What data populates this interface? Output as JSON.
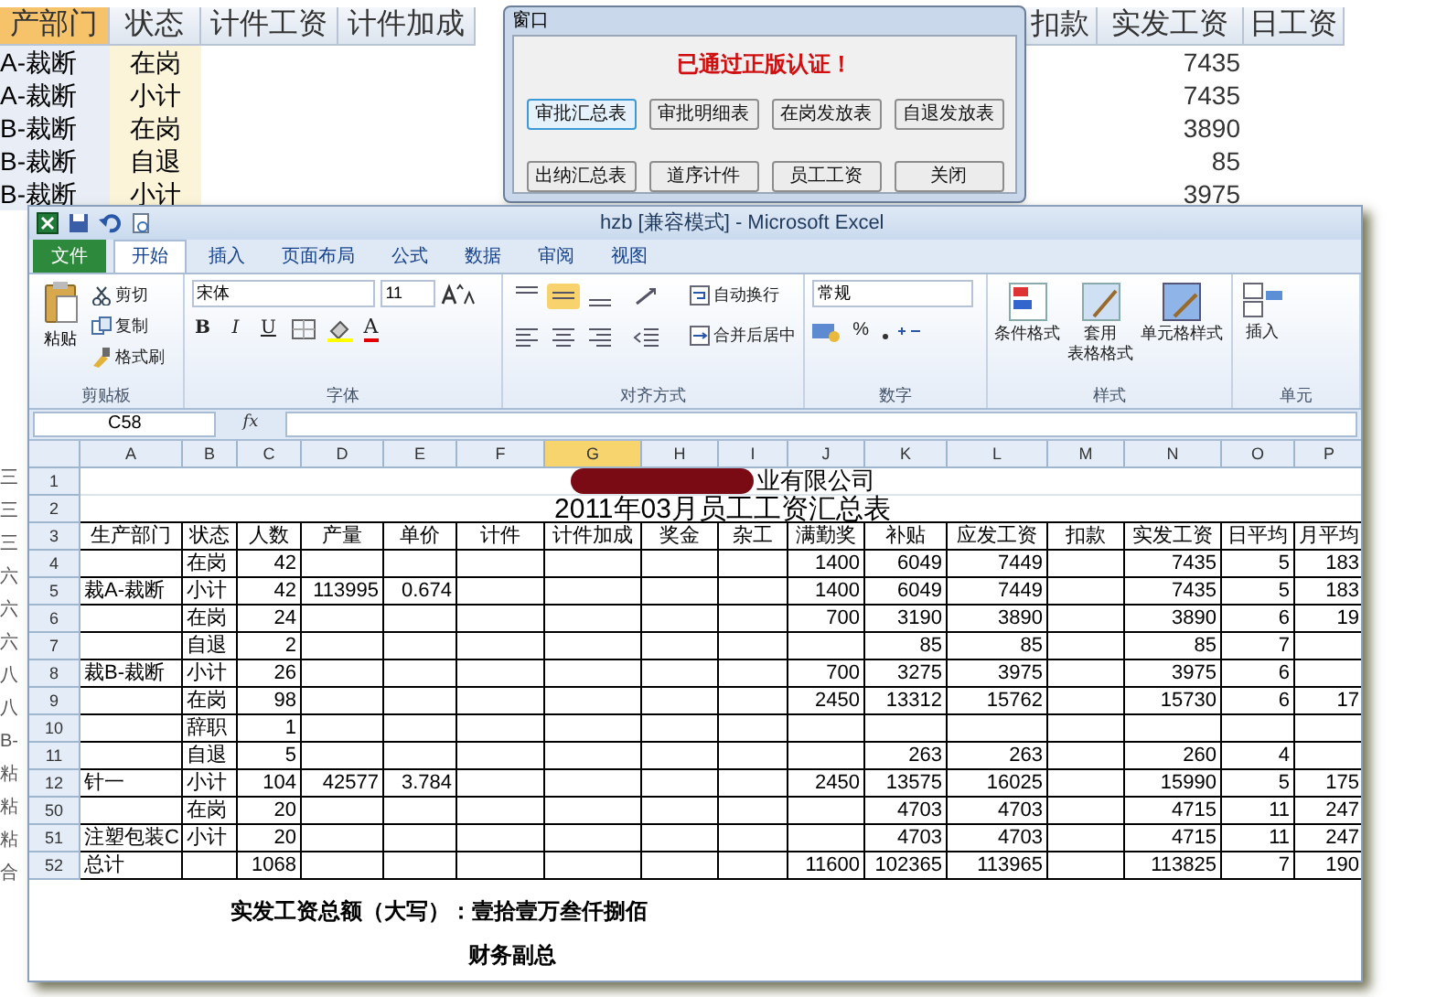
{
  "background_sheet": {
    "columns": [
      {
        "label": "产部门",
        "selected": true
      },
      {
        "label": "状态",
        "selected": false
      },
      {
        "label": "计件工资",
        "selected": false
      },
      {
        "label": "计件加成",
        "selected": false
      },
      {
        "label": "扣款",
        "selected": false
      },
      {
        "label": "实发工资",
        "selected": false
      },
      {
        "label": "日工资",
        "selected": false
      }
    ],
    "rows": [
      {
        "dept": "A-裁断",
        "status": "在岗",
        "net_pay": "7435"
      },
      {
        "dept": "A-裁断",
        "status": "小计",
        "net_pay": "7435"
      },
      {
        "dept": "B-裁断",
        "status": "在岗",
        "net_pay": "3890"
      },
      {
        "dept": "B-裁断",
        "status": "自退",
        "net_pay": "85"
      },
      {
        "dept": "B-裁断",
        "status": "小计",
        "net_pay": "3975"
      }
    ],
    "edge_labels": [
      "三",
      "三",
      "三",
      "六",
      "六",
      "六",
      "八",
      "八",
      "B-",
      "粘",
      "粘",
      "粘",
      "合"
    ]
  },
  "dialog": {
    "title": "窗口",
    "message": "已通过正版认证！",
    "buttons": [
      {
        "label": "审批汇总表",
        "focused": true
      },
      {
        "label": "审批明细表",
        "focused": false
      },
      {
        "label": "在岗发放表",
        "focused": false
      },
      {
        "label": "自退发放表",
        "focused": false
      },
      {
        "label": "出纳汇总表",
        "focused": false
      },
      {
        "label": "道序计件",
        "focused": false
      },
      {
        "label": "员工工资",
        "focused": false
      },
      {
        "label": "关闭",
        "focused": false
      }
    ]
  },
  "excel": {
    "title": "hzb  [兼容模式] - Microsoft Excel",
    "tabs": [
      {
        "label": "文件",
        "kind": "file",
        "selected": false
      },
      {
        "label": "开始",
        "kind": "tab",
        "selected": true
      },
      {
        "label": "插入",
        "kind": "tab",
        "selected": false
      },
      {
        "label": "页面布局",
        "kind": "tab",
        "selected": false
      },
      {
        "label": "公式",
        "kind": "tab",
        "selected": false
      },
      {
        "label": "数据",
        "kind": "tab",
        "selected": false
      },
      {
        "label": "审阅",
        "kind": "tab",
        "selected": false
      },
      {
        "label": "视图",
        "kind": "tab",
        "selected": false
      }
    ],
    "ribbon": {
      "clipboard": {
        "label": "剪贴板",
        "paste": "粘贴",
        "items": [
          "剪切",
          "复制",
          "格式刷"
        ]
      },
      "font": {
        "label": "字体",
        "font_name": "宋体",
        "font_size": "11",
        "styles": [
          "B",
          "I",
          "U"
        ],
        "color_letter": "A"
      },
      "alignment": {
        "label": "对齐方式",
        "wrap": "自动换行",
        "merge": "合并后居中"
      },
      "number": {
        "label": "数字",
        "format": "常规",
        "percent": "%"
      },
      "styles": {
        "label": "样式",
        "items": [
          [
            "条件格式"
          ],
          [
            "套用",
            "表格格式"
          ],
          [
            "单元格样式"
          ]
        ]
      },
      "cells": {
        "label": "单元",
        "items": [
          "插入"
        ]
      }
    },
    "name_box": "C58",
    "function_label": "fx",
    "columns": [
      {
        "label": "A",
        "selected": false
      },
      {
        "label": "B",
        "selected": false
      },
      {
        "label": "C",
        "selected": false
      },
      {
        "label": "D",
        "selected": false
      },
      {
        "label": "E",
        "selected": false
      },
      {
        "label": "F",
        "selected": false
      },
      {
        "label": "G",
        "selected": true
      },
      {
        "label": "H",
        "selected": false
      },
      {
        "label": "I",
        "selected": false
      },
      {
        "label": "J",
        "selected": false
      },
      {
        "label": "K",
        "selected": false
      },
      {
        "label": "L",
        "selected": false
      },
      {
        "label": "M",
        "selected": false
      },
      {
        "label": "N",
        "selected": false
      },
      {
        "label": "O",
        "selected": false
      },
      {
        "label": "P",
        "selected": false
      }
    ],
    "rows": [
      {
        "number": "1",
        "kind": "company",
        "text": "业有限公司"
      },
      {
        "number": "2",
        "kind": "title",
        "text": "2011年03月员工工资汇总表"
      },
      {
        "number": "3",
        "kind": "header",
        "cells": [
          "生产部门",
          "状态",
          "人数",
          "产量",
          "单价",
          "计件",
          "计件加成",
          "奖金",
          "杂工",
          "满勤奖",
          "补贴",
          "应发工资",
          "扣款",
          "实发工资",
          "日平均",
          "月平均"
        ]
      },
      {
        "number": "4",
        "kind": "data",
        "cells": [
          null,
          "在岗",
          "42",
          null,
          null,
          null,
          null,
          null,
          null,
          "1400",
          "6049",
          "7449",
          null,
          "7435",
          "5",
          "183"
        ]
      },
      {
        "number": "5",
        "kind": "data",
        "cells": [
          "裁A-裁断",
          "小计",
          "42",
          "113995",
          "0.674",
          null,
          null,
          null,
          null,
          "1400",
          "6049",
          "7449",
          null,
          "7435",
          "5",
          "183"
        ]
      },
      {
        "number": "6",
        "kind": "data",
        "cells": [
          null,
          "在岗",
          "24",
          null,
          null,
          null,
          null,
          null,
          null,
          "700",
          "3190",
          "3890",
          null,
          "3890",
          "6",
          "19"
        ]
      },
      {
        "number": "7",
        "kind": "data",
        "cells": [
          null,
          "自退",
          "2",
          null,
          null,
          null,
          null,
          null,
          null,
          null,
          "85",
          "85",
          null,
          "85",
          "7"
        ]
      },
      {
        "number": "8",
        "kind": "data",
        "cells": [
          "裁B-裁断",
          "小计",
          "26",
          null,
          null,
          null,
          null,
          null,
          null,
          "700",
          "3275",
          "3975",
          null,
          "3975",
          "6"
        ]
      },
      {
        "number": "9",
        "kind": "data",
        "cells": [
          null,
          "在岗",
          "98",
          null,
          null,
          null,
          null,
          null,
          null,
          "2450",
          "13312",
          "15762",
          null,
          "15730",
          "6",
          "17"
        ]
      },
      {
        "number": "10",
        "kind": "data",
        "cells": [
          null,
          "辞职",
          "1"
        ]
      },
      {
        "number": "11",
        "kind": "data",
        "cells": [
          null,
          "自退",
          "5",
          null,
          null,
          null,
          null,
          null,
          null,
          null,
          "263",
          "263",
          null,
          "260",
          "4"
        ]
      },
      {
        "number": "12",
        "kind": "data",
        "cells": [
          "针一",
          "小计",
          "104",
          "42577",
          "3.784",
          null,
          null,
          null,
          null,
          "2450",
          "13575",
          "16025",
          null,
          "15990",
          "5",
          "175"
        ]
      },
      {
        "number": "50",
        "kind": "data",
        "cells": [
          null,
          "在岗",
          "20",
          null,
          null,
          null,
          null,
          null,
          null,
          null,
          "4703",
          "4703",
          null,
          "4715",
          "11",
          "247"
        ]
      },
      {
        "number": "51",
        "kind": "data",
        "cells": [
          "注塑包装C",
          "小计",
          "20",
          null,
          null,
          null,
          null,
          null,
          null,
          null,
          "4703",
          "4703",
          null,
          "4715",
          "11",
          "247"
        ]
      },
      {
        "number": "52",
        "kind": "data",
        "cells": [
          "总计",
          null,
          "1068",
          null,
          null,
          null,
          null,
          null,
          null,
          "11600",
          "102365",
          "113965",
          null,
          "113825",
          "7",
          "190"
        ]
      }
    ],
    "footer_lines": [
      "实发工资总额（大写）：壹拾壹万叁仟捌佰",
      "财务副总"
    ]
  }
}
